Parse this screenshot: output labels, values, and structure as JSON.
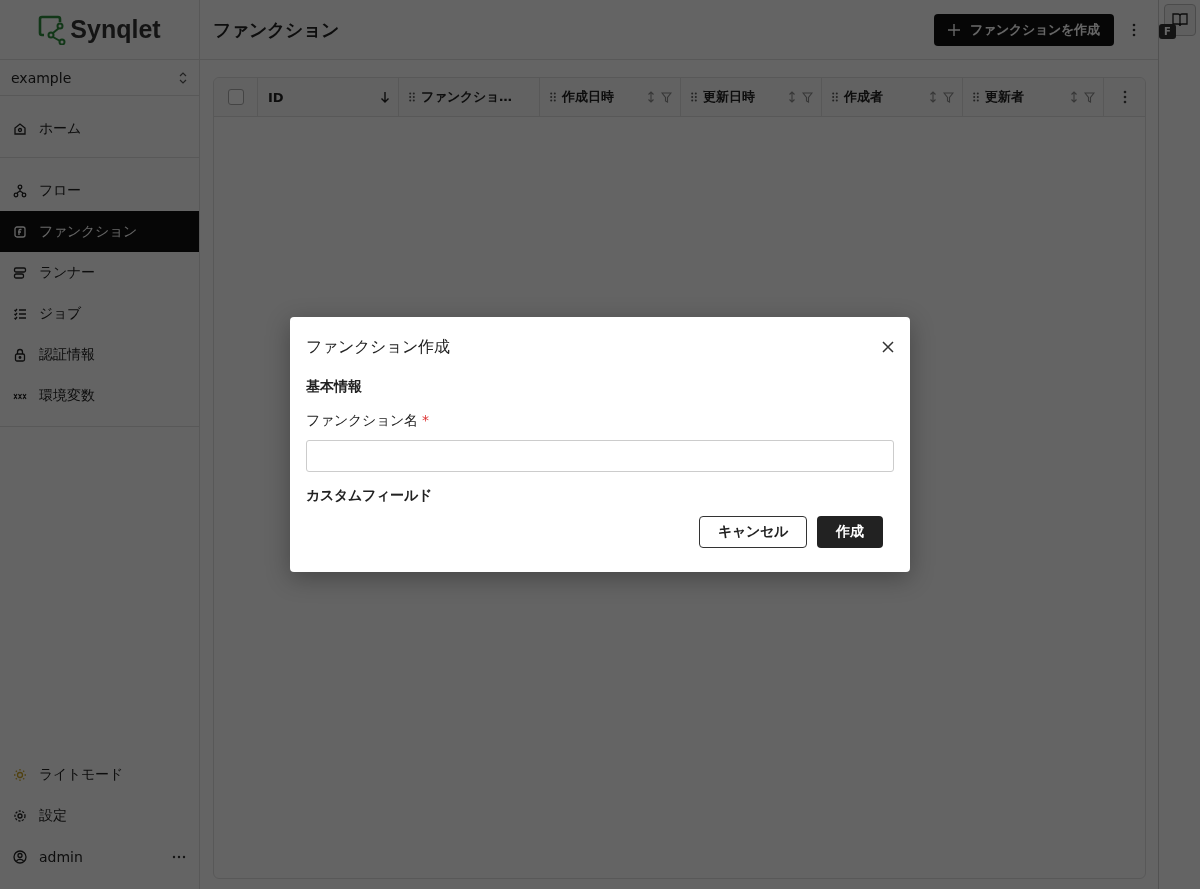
{
  "sidebar": {
    "logo": "Synqlet",
    "workspace": "example",
    "nav_groups": [
      [
        {
          "label": "ホーム",
          "selected": false
        }
      ],
      [
        {
          "label": "フロー",
          "selected": false
        },
        {
          "label": "ファンクション",
          "selected": true
        },
        {
          "label": "ランナー",
          "selected": false
        },
        {
          "label": "ジョブ",
          "selected": false
        },
        {
          "label": "認証情報",
          "selected": false
        },
        {
          "label": "環境変数",
          "selected": false
        }
      ]
    ],
    "bottom_items": [
      {
        "label": "ライトモード"
      },
      {
        "label": "設定"
      },
      {
        "label": "admin",
        "more": true
      }
    ]
  },
  "header": {
    "title": "ファンクション",
    "create_button": "ファンクションを作成"
  },
  "table": {
    "select_all": {
      "checked": false
    },
    "columns": [
      {
        "label": "ID",
        "sorted": true,
        "filter": false,
        "draggable": false
      },
      {
        "label": "ファンクショ…",
        "sortable": false,
        "sorted": false,
        "filter": false,
        "draggable": true
      },
      {
        "label": "作成日時",
        "sortable": true,
        "sorted": false,
        "filter": true,
        "draggable": true
      },
      {
        "label": "更新日時",
        "sortable": true,
        "sorted": false,
        "filter": true,
        "draggable": true
      },
      {
        "label": "作成者",
        "sortable": true,
        "sorted": false,
        "filter": true,
        "draggable": true
      },
      {
        "label": "更新者",
        "sortable": true,
        "sorted": false,
        "filter": true,
        "draggable": true
      }
    ]
  },
  "right_panel": {
    "badge": "F"
  },
  "dialog": {
    "title": "ファンクション作成",
    "section_basic": "基本情報",
    "name_label": "ファンクション名",
    "required_mark": "*",
    "section_custom": "カスタムフィールド",
    "cancel": "キャンセル",
    "submit": "作成"
  }
}
